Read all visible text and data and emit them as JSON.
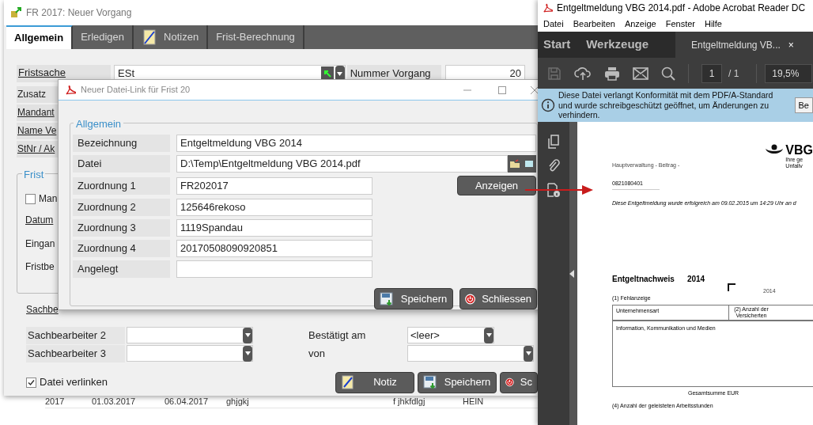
{
  "main_window": {
    "title": "FR 2017: Neuer Vorgang",
    "tabs": [
      {
        "label": "Allgemein",
        "selected": true,
        "kind": "text"
      },
      {
        "label": "Erledigen",
        "selected": false,
        "kind": "text"
      },
      {
        "label": "Notizen",
        "selected": false,
        "kind": "note"
      },
      {
        "label": "Frist-Berechnung",
        "selected": false,
        "kind": "text"
      }
    ],
    "fristsache": {
      "label": "Fristsache",
      "value": "ESt"
    },
    "nummer_vorgang": {
      "label": "Nummer Vorgang",
      "value": "20"
    },
    "side_labels": [
      {
        "text": "Zusatz",
        "link": false
      },
      {
        "text": "Mandant",
        "link": true
      },
      {
        "text": "Name Ve",
        "link": true
      },
      {
        "text": "StNr / Ak",
        "link": true
      }
    ],
    "frist_group": {
      "legend": "Frist",
      "checkbox": {
        "label": "Man",
        "checked": false
      },
      "labels": [
        {
          "text": "Datum",
          "link": true
        },
        {
          "text": "Eingan",
          "link": false
        },
        {
          "text": "Fristbe",
          "link": false
        }
      ]
    },
    "sachbearbeiter_label": "Sachbe",
    "left_rows": [
      {
        "label": "Sachbearbeiter 2"
      },
      {
        "label": "Sachbearbeiter 3"
      }
    ],
    "right_rows": [
      {
        "label": "Bestätigt am",
        "value": "<leer>"
      },
      {
        "label": "von"
      }
    ],
    "link_checkbox": {
      "label": "Datei verlinken",
      "checked": true
    },
    "buttons": [
      {
        "label": "Notiz",
        "kind": "note"
      },
      {
        "label": "Speichern",
        "kind": "save"
      },
      {
        "label": "Sc",
        "kind": "close"
      }
    ]
  },
  "background_row": [
    "2017",
    "01.03.2017",
    "06.04.2017",
    "ghjgkj",
    "f jhkfdlgj",
    "HEIN"
  ],
  "dialog": {
    "title": "Neuer Datei-Link für Frist 20",
    "legend": "Allgemein",
    "fields": [
      {
        "label": "Bezeichnung",
        "value": "Entgeltmeldung VBG 2014",
        "kind": "wide"
      },
      {
        "label": "Datei",
        "value": "D:\\Temp\\Entgeltmeldung VBG 2014.pdf",
        "kind": "file"
      },
      {
        "label": "Zuordnung 1",
        "value": "FR202017",
        "kind": "short",
        "action": "Anzeigen"
      },
      {
        "label": "Zuordnung 2",
        "value": "125646rekoso",
        "kind": "short"
      },
      {
        "label": "Zuordnung 3",
        "value": "1119Spandau",
        "kind": "short"
      },
      {
        "label": "Zuordnung 4",
        "value": "20170508090920851",
        "kind": "short"
      },
      {
        "label": "Angelegt",
        "kind": "short"
      }
    ],
    "buttons": [
      {
        "label": "Speichern",
        "kind": "save"
      },
      {
        "label": "Schliessen",
        "kind": "close"
      }
    ]
  },
  "acrobat": {
    "title": "Entgeltmeldung VBG 2014.pdf - Adobe Acrobat Reader DC",
    "menu": [
      "Datei",
      "Bearbeiten",
      "Anzeige",
      "Fenster",
      "Hilfe"
    ],
    "tabs": [
      {
        "label": "Start",
        "selected": false
      },
      {
        "label": "Werkzeuge",
        "selected": false
      },
      {
        "label": "Entgeltmeldung VB...",
        "selected": true,
        "close": "×"
      }
    ],
    "page_current": "1",
    "page_total": "/ 1",
    "zoom": "19,5%",
    "info": {
      "text": "Diese Datei verlangt Konformität mit dem PDF/A-Standard und wurde schreibgeschützt geöffnet, um Änderungen zu verhindern.",
      "button": "Be"
    },
    "document": {
      "header": "Hauptverwaltung - Beitrag -",
      "logo": "VBG",
      "logo_lines": [
        "Ihre ge",
        "Unfallv"
      ],
      "customer_number": "0821080401",
      "notice": "Diese Entgeltmeldung wurde erfolgreich am 09.02.2015 um 14:29 Uhr an d",
      "heading": "Entgeltnachweis",
      "heading_year": "2014",
      "year": "2014",
      "section_1": "(1) Fehlanzeige",
      "table": {
        "columns": [
          "Unternehmensart",
          "(2) Anzahl der Versicherten"
        ],
        "rows": [
          "Information, Kommunikation und Medien"
        ]
      },
      "total_label": "Gesamtsumme EUR",
      "section_4": "(4) Anzahl der geleisteten Arbeitsstunden"
    }
  }
}
